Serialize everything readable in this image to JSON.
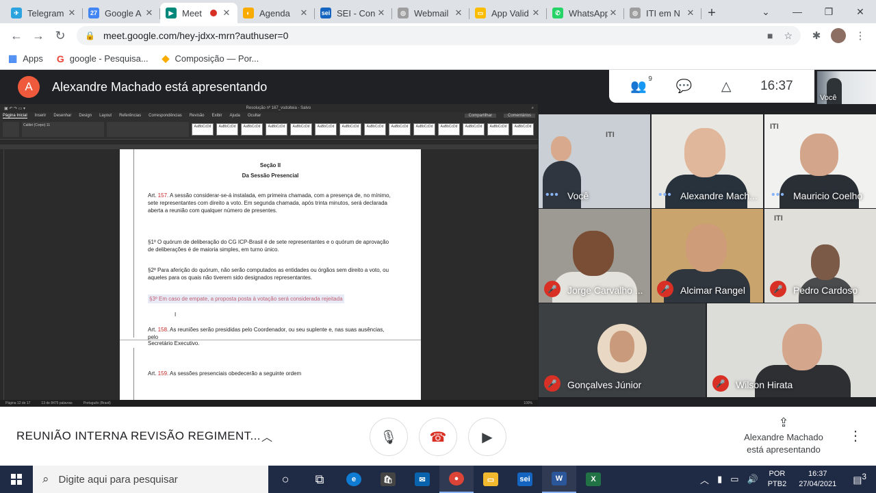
{
  "browser": {
    "tabs": [
      {
        "label": "Telegram",
        "icon": "telegram-icon",
        "color": "#2aa3df",
        "glyph": "✈"
      },
      {
        "label": "Google A",
        "icon": "calendar-icon",
        "color": "#4285f4",
        "glyph": "27"
      },
      {
        "label": "Meet",
        "icon": "meet-icon",
        "color": "#00897b",
        "glyph": "▶",
        "active": true
      },
      {
        "label": "Agenda",
        "icon": "agenda-icon",
        "color": "#f9ab00",
        "glyph": "◐"
      },
      {
        "label": "SEI - Con",
        "icon": "sei-icon",
        "color": "#1565c0",
        "glyph": "sei"
      },
      {
        "label": "Webmail",
        "icon": "webmail-icon",
        "color": "#9e9e9e",
        "glyph": "◎"
      },
      {
        "label": "App Valid",
        "icon": "app-valid-icon",
        "color": "#fbbc04",
        "glyph": "▭"
      },
      {
        "label": "WhatsApp",
        "icon": "whatsapp-icon",
        "color": "#25d366",
        "glyph": "✆"
      },
      {
        "label": "ITI em N",
        "icon": "iti-icon",
        "color": "#9e9e9e",
        "glyph": "◎"
      }
    ],
    "url": "meet.google.com/hey-jdxx-mrn?authuser=0",
    "bookmarks": [
      {
        "label": "Apps",
        "icon": "apps-icon"
      },
      {
        "label": "google - Pesquisa...",
        "icon": "google-icon"
      },
      {
        "label": "Composição — Por...",
        "icon": "composicao-icon"
      }
    ]
  },
  "meet": {
    "presenter_initial": "A",
    "presenter_banner": "Alexandre Machado está apresentando",
    "participant_count": "9",
    "clock": "16:37",
    "self_label": "Você",
    "meeting_title": "REUNIÃO INTERNA REVISÃO REGIMENT...",
    "presenting_info_line1": "Alexandre Machado",
    "presenting_info_line2": "está apresentando",
    "participants": [
      {
        "name": "Você",
        "muted": false,
        "speaking": true
      },
      {
        "name": "Alexandre Mach...",
        "muted": false,
        "speaking": true
      },
      {
        "name": "Mauricio Coelho",
        "muted": false,
        "speaking": true
      },
      {
        "name": "Jorge Carvalho ...",
        "muted": true
      },
      {
        "name": "Alcimar Rangel",
        "muted": true
      },
      {
        "name": "Pedro Cardoso",
        "muted": true
      },
      {
        "name": "Gonçalves Júnior",
        "muted": true
      },
      {
        "name": "Wilson Hirata",
        "muted": true
      }
    ],
    "tile_logos": {
      "iti": "ITI"
    }
  },
  "document": {
    "window_title": "Resolução nº 167_vsdoiteia - Salvo",
    "ribbon_tabs": [
      "Página Inicial",
      "Inserir",
      "Desenhar",
      "Design",
      "Layout",
      "Referências",
      "Correspondências",
      "Revisão",
      "Exibir",
      "Ajuda",
      "Ocultar"
    ],
    "share_label": "Compartilhar",
    "comments_label": "Comentários",
    "font_name": "Calibri (Corpo)",
    "font_size": "11",
    "styles": [
      "AaBbCcDd",
      "AaBbCcDd",
      "AaBbCcDd",
      "AaBbCcDd",
      "AaBbCcDd",
      "AaBbCcDd",
      "AaBbCcDd",
      "AaBbCcDd",
      "AaBbCcDd",
      "AaBbCcDd",
      "AaBbCcDd",
      "AaBbCcDd",
      "AaBbCcDd",
      "AaBbCcDd"
    ],
    "section_title": "Seção II",
    "section_subtitle": "Da Sessão Presencial",
    "art157_num": "157",
    "art157_pre": "Art. ",
    "art157_text": ". A sessão considerar-se-á instalada, em primeira chamada, com a presença de, no mínimo, sete representantes com direito a voto. Em segunda chamada, após trinta minutos, será declarada aberta a reunião com qualquer número de presentes.",
    "par1": "§1º O quórum de deliberação do CG ICP-Brasil é de sete representantes e o quórum de aprovação de deliberações é de maioria simples, em turno único.",
    "par2": "§2º Para aferição do quórum, não serão computados as entidades ou órgãos sem direito a voto, ou aqueles para os quais não tiverem sido designados representantes.",
    "par3": "§3º Em caso de empate, a proposta posta à votação será considerada rejeitada",
    "art158_pre": "Art. ",
    "art158_num": "158",
    "art158_text": ". As reuniões serão presididas pelo Coordenador, ou seu suplente e, nas suas ausências, pelo",
    "art158_cont": "Secretário Executivo.",
    "art159_pre": "Art. ",
    "art159_num": "159",
    "art159_text": ". As sessões presenciais obedecerão a seguinte ordem",
    "status_left": "Página 12 de 17",
    "status_words": "13 de 8475 palavras",
    "status_lang": "Português (Brasil)",
    "status_zoom": "100%"
  },
  "taskbar": {
    "search_placeholder": "Digite aqui para pesquisar",
    "lang_line1": "POR",
    "lang_line2": "PTB2",
    "time": "16:37",
    "date": "27/04/2021",
    "notif_count": "3"
  },
  "colors": {
    "meet_bg": "#202124",
    "mute_red": "#d93025",
    "accent_blue": "#8ab4f8",
    "avatar_orange": "#ef5a3c"
  }
}
